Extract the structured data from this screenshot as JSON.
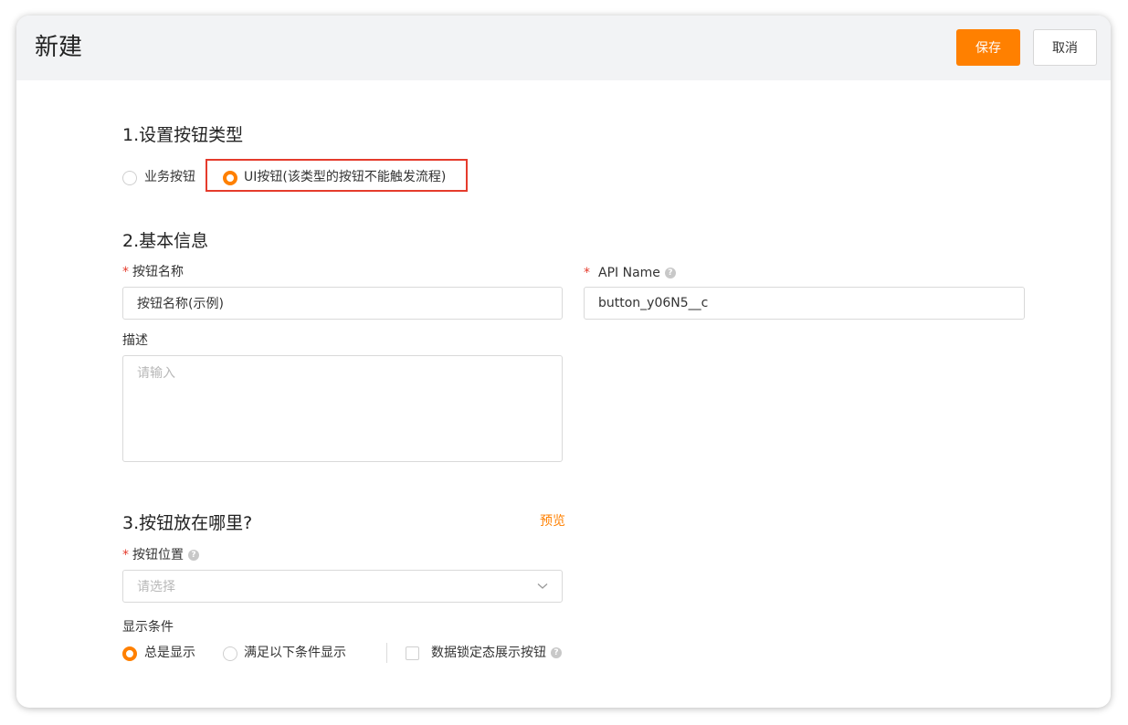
{
  "header": {
    "title": "新建",
    "save_label": "保存",
    "cancel_label": "取消"
  },
  "section1": {
    "title": "1.设置按钮类型",
    "options": [
      {
        "label": "业务按钮",
        "selected": false
      },
      {
        "label": "UI按钮(该类型的按钮不能触发流程)",
        "selected": true
      }
    ]
  },
  "section2": {
    "title": "2.基本信息",
    "button_name": {
      "label": "按钮名称",
      "required": "*",
      "value": "按钮名称(示例)"
    },
    "api_name": {
      "label": "API Name",
      "required": "*",
      "value": "button_y06N5__c",
      "help": "?"
    },
    "description": {
      "label": "描述",
      "placeholder": "请输入"
    }
  },
  "section3": {
    "title": "3.按钮放在哪里?",
    "preview_label": "预览",
    "position": {
      "label": "按钮位置",
      "required": "*",
      "placeholder": "请选择",
      "help": "?"
    },
    "display_condition": {
      "label": "显示条件",
      "options": [
        {
          "label": "总是显示",
          "selected": true
        },
        {
          "label": "满足以下条件显示",
          "selected": false
        }
      ],
      "lock_checkbox": {
        "label": "数据锁定态展示按钮",
        "checked": false,
        "help": "?"
      }
    }
  },
  "colors": {
    "accent": "#ff8000",
    "required": "#e53b2c",
    "header_bg": "#f2f3f5"
  },
  "icons": [
    "help-icon",
    "chevron-down-icon"
  ]
}
